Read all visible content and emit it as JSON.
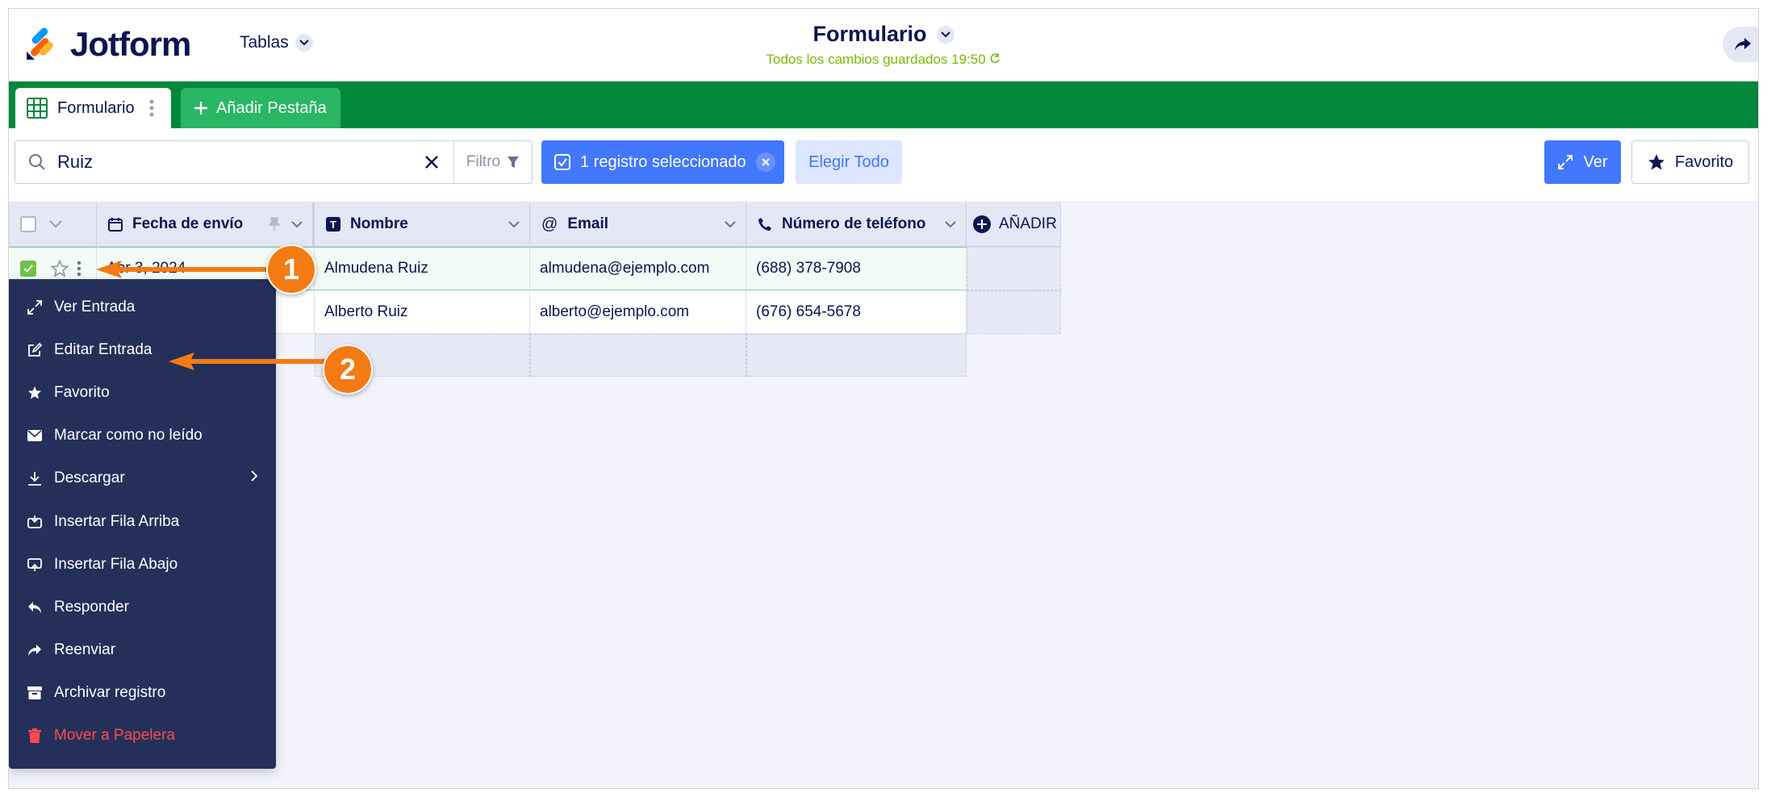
{
  "app": {
    "brand": "Jotform",
    "section_dropdown": "Tablas",
    "title": "Formulario",
    "saved_status": "Todos los cambios guardados 19:50"
  },
  "tabs": [
    {
      "label": "Formulario",
      "active": true
    },
    {
      "label": "Añadir Pestaña",
      "active": false
    }
  ],
  "toolbar": {
    "search_value": "Ruiz",
    "filter_label": "Filtro",
    "selected_label": "1 registro seleccionado",
    "select_all_label": "Elegir Todo",
    "view_label": "Ver",
    "favorite_label": "Favorito"
  },
  "table": {
    "columns": [
      {
        "label": "Fecha de envío",
        "icon": "calendar-icon"
      },
      {
        "label": "Nombre",
        "icon": "text-icon"
      },
      {
        "label": "Email",
        "icon": "at-icon"
      },
      {
        "label": "Número de teléfono",
        "icon": "phone-icon"
      }
    ],
    "add_column_label": "AÑADIR",
    "rows": [
      {
        "date": "Abr 3, 2024",
        "name": "Almudena Ruiz",
        "email": "almudena@ejemplo.com",
        "phone": "(688) 378-7908",
        "selected": true
      },
      {
        "date": "",
        "name": "Alberto Ruiz",
        "email": "alberto@ejemplo.com",
        "phone": "(676) 654-5678",
        "selected": false
      }
    ]
  },
  "context_menu": {
    "items": [
      {
        "label": "Ver Entrada",
        "icon": "expand-icon"
      },
      {
        "label": "Editar Entrada",
        "icon": "edit-icon"
      },
      {
        "label": "Favorito",
        "icon": "star-icon"
      },
      {
        "label": "Marcar como no leído",
        "icon": "envelope-icon"
      },
      {
        "label": "Descargar",
        "icon": "download-icon"
      },
      {
        "label": "Insertar Fila Arriba",
        "icon": "insert-above-icon"
      },
      {
        "label": "Insertar Fila Abajo",
        "icon": "insert-below-icon"
      },
      {
        "label": "Responder",
        "icon": "reply-icon"
      },
      {
        "label": "Reenviar",
        "icon": "forward-icon"
      },
      {
        "label": "Archivar registro",
        "icon": "archive-icon"
      },
      {
        "label": "Mover a Papelera",
        "icon": "trash-icon"
      }
    ]
  },
  "callouts": [
    "1",
    "2"
  ],
  "colors": {
    "brand_navy": "#0a1551",
    "tab_green": "#01883a",
    "primary_blue": "#4277ff",
    "menu_bg": "#24305a",
    "danger": "#ff4b4b",
    "callout_orange": "#f47b13",
    "saved_green": "#78bb07"
  }
}
